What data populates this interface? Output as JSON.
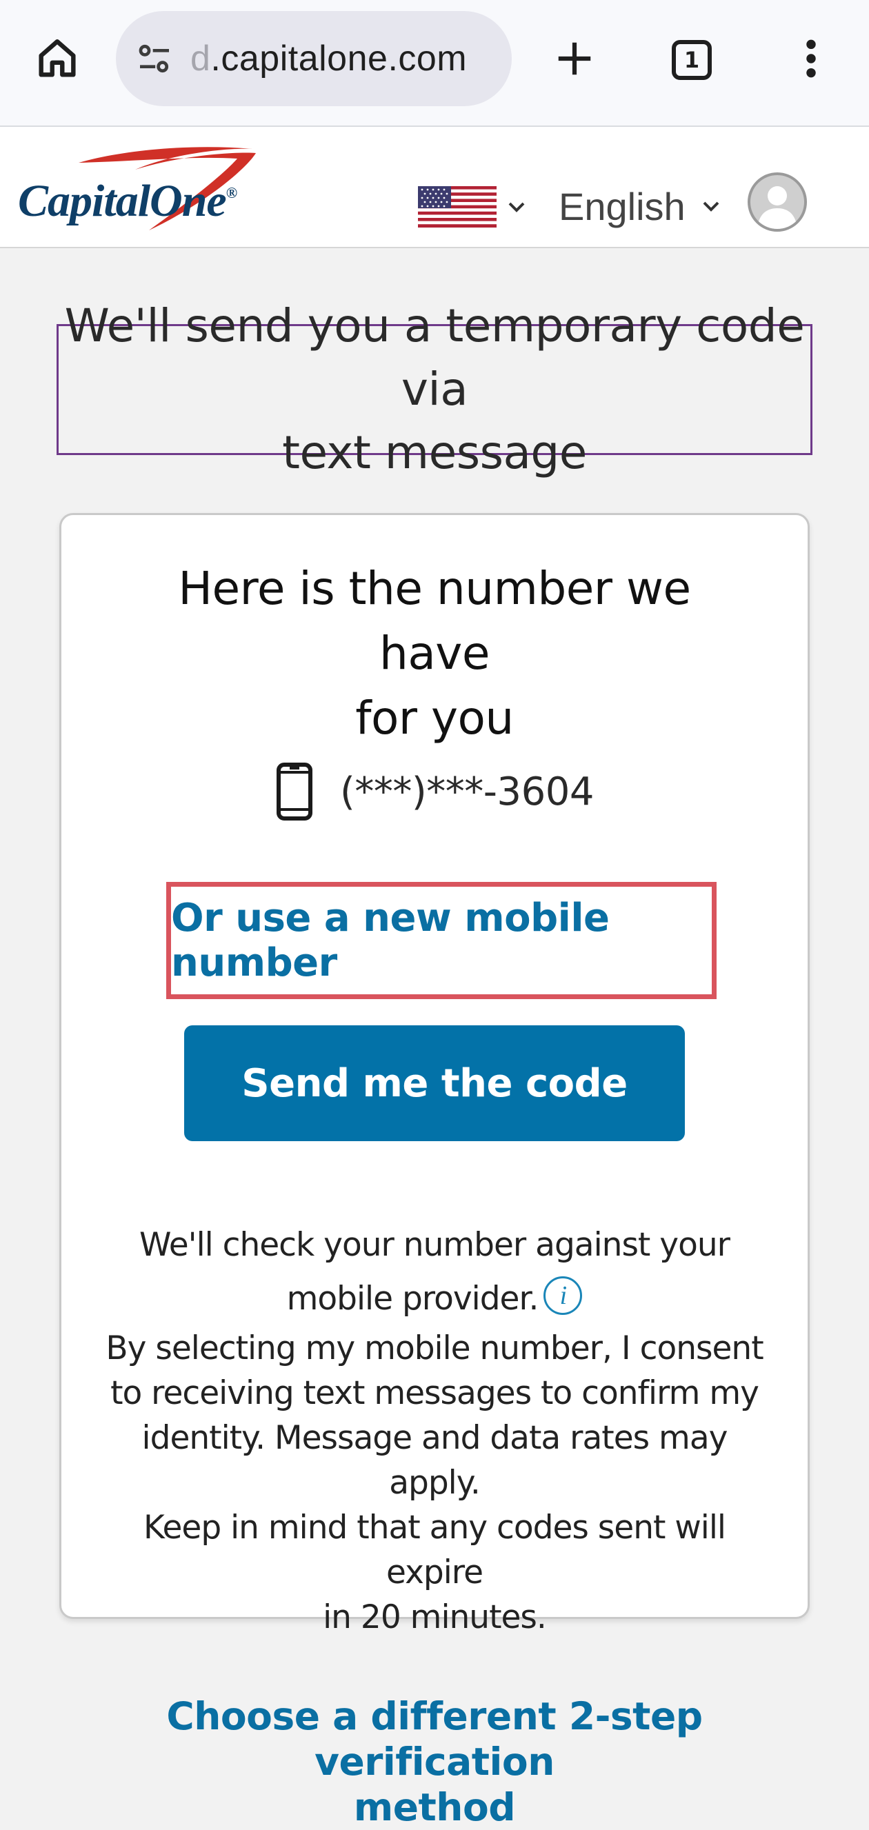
{
  "browser": {
    "url_faded_prefix": "d",
    "url_visible": ".capitalone.com",
    "tab_count": "1",
    "icons": {
      "home": "home-icon",
      "site_info": "tune-icon",
      "new_tab": "plus-icon",
      "tabs": "tab-switcher-icon",
      "menu": "more-vert-icon"
    }
  },
  "header": {
    "logo_text": "Capital One",
    "logo_wordmark_a": "Capital",
    "logo_wordmark_b": "One",
    "logo_mark": "®",
    "country_flag": "us-flag-icon",
    "language_label": "English",
    "avatar_icon": "user-avatar-icon"
  },
  "main": {
    "heading_line1": "We'll send you a temporary code via",
    "heading_line2": "text message",
    "card": {
      "title_line1": "Here is the number we have",
      "title_line2": "for you",
      "masked_number": "(***)***-3604",
      "new_number_link": "Or use a new mobile number",
      "send_button": "Send me the code",
      "check_line1": "We'll check your number against your",
      "check_line2": "mobile provider.",
      "info_glyph": "i",
      "consent_line1": "By selecting my mobile number, I consent",
      "consent_line2": "to receiving text messages to confirm my",
      "consent_line3": "identity. Message and data rates may apply.",
      "consent_line4": "Keep in mind that any codes sent will expire",
      "consent_line5": "in 20 minutes."
    },
    "different_method_line1": "Choose a different 2-step verification",
    "different_method_line2": "method"
  },
  "colors": {
    "brand_blue": "#0372a8",
    "link_blue": "#0a6fa3",
    "logo_navy": "#0f3f68",
    "logo_red": "#d03027",
    "highlight_red": "#d9545d",
    "heading_outline": "#6f3a8a",
    "page_bg": "#f2f2f2"
  }
}
